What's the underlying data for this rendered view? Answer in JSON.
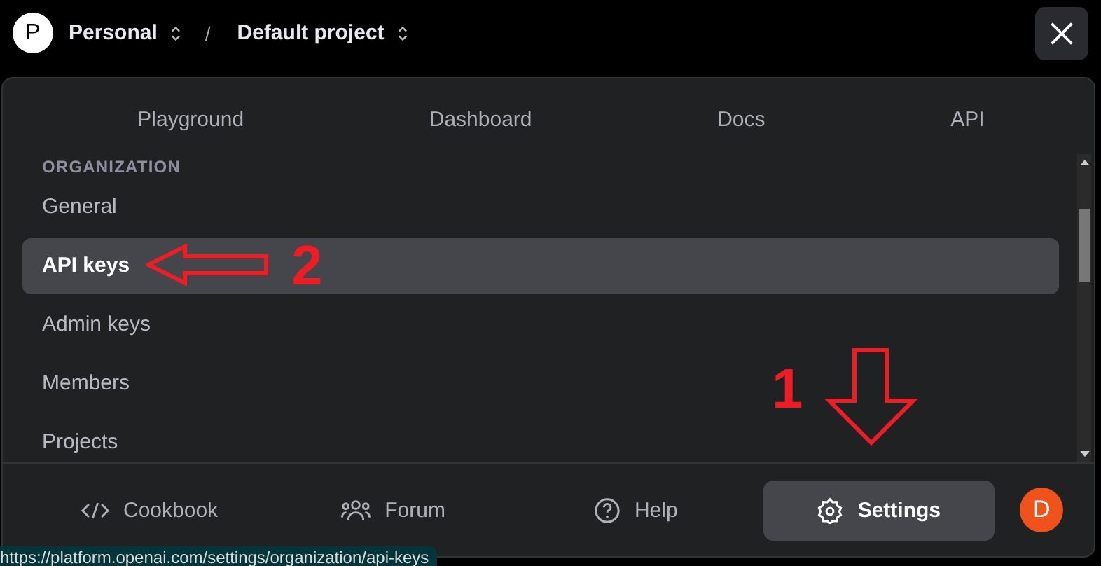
{
  "breadcrumb": {
    "avatar": "P",
    "org": "Personal",
    "separator": "/",
    "project": "Default project"
  },
  "nav": [
    "Playground",
    "Dashboard",
    "Docs",
    "API"
  ],
  "sidebar": {
    "heading": "ORGANIZATION",
    "items": [
      {
        "label": "General",
        "selected": false
      },
      {
        "label": "API keys",
        "selected": true
      },
      {
        "label": "Admin keys",
        "selected": false
      },
      {
        "label": "Members",
        "selected": false
      },
      {
        "label": "Projects",
        "selected": false
      }
    ]
  },
  "footer": [
    {
      "label": "Cookbook",
      "kind": "code",
      "selected": false
    },
    {
      "label": "Forum",
      "kind": "people",
      "selected": false
    },
    {
      "label": "Help",
      "kind": "help",
      "selected": false
    },
    {
      "label": "Settings",
      "kind": "gear",
      "selected": true
    }
  ],
  "user_avatar": "D",
  "annotations": [
    {
      "label": "2"
    },
    {
      "label": "1"
    }
  ],
  "status_bar": {
    "url": "https://platform.openai.com/settings/organization/api-keys"
  }
}
